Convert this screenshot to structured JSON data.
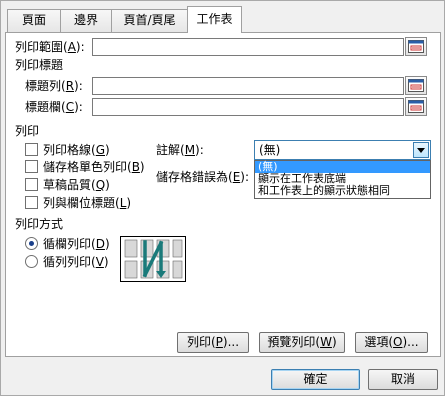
{
  "tabs": [
    {
      "label": "頁面"
    },
    {
      "label": "邊界"
    },
    {
      "label": "頁首/頁尾"
    },
    {
      "label": "工作表"
    }
  ],
  "print_area": {
    "label": "列印範圍(",
    "key": "A",
    "tail": "):",
    "value": ""
  },
  "print_titles": {
    "group_label": "列印標題",
    "rows": {
      "label": "標題列(",
      "key": "R",
      "tail": "):",
      "value": ""
    },
    "cols": {
      "label": "標題欄(",
      "key": "C",
      "tail": "):",
      "value": ""
    }
  },
  "print": {
    "group_label": "列印",
    "checkboxes": [
      {
        "label": "列印格線(",
        "key": "G",
        "tail": ")",
        "checked": false
      },
      {
        "label": "儲存格單色列印(",
        "key": "B",
        "tail": ")",
        "checked": false
      },
      {
        "label": "草稿品質(",
        "key": "Q",
        "tail": ")",
        "checked": false
      },
      {
        "label": "列與欄位標題(",
        "key": "L",
        "tail": ")",
        "checked": false
      }
    ],
    "comments": {
      "label": "註解(",
      "key": "M",
      "tail": "):",
      "value": "(無)",
      "options": [
        "(無)",
        "顯示在工作表底端",
        "和工作表上的顯示狀態相同"
      ],
      "selected_index": 0
    },
    "cell_errors": {
      "label": "儲存格錯誤為(",
      "key": "E",
      "tail": "):"
    }
  },
  "page_order": {
    "group_label": "列印方式",
    "options": [
      {
        "label": "循欄列印(",
        "key": "D",
        "tail": ")",
        "selected": true
      },
      {
        "label": "循列列印(",
        "key": "V",
        "tail": ")",
        "selected": false
      }
    ],
    "preview_icon": "page-order-down-then-over-icon"
  },
  "buttons": {
    "print": {
      "label": "列印(",
      "key": "P",
      "tail": ")..."
    },
    "preview": {
      "label": "預覽列印(",
      "key": "W",
      "tail": ")"
    },
    "options": {
      "label": "選項(",
      "key": "O",
      "tail": ")..."
    },
    "ok": {
      "label": "確定"
    },
    "cancel": {
      "label": "取消"
    }
  },
  "icons": {
    "range_picker": "collapse-dialog-icon",
    "dropdown_arrow": "chevron-down-icon"
  },
  "colors": {
    "selection": "#3399ff",
    "arrow": "#1a7a7a"
  }
}
